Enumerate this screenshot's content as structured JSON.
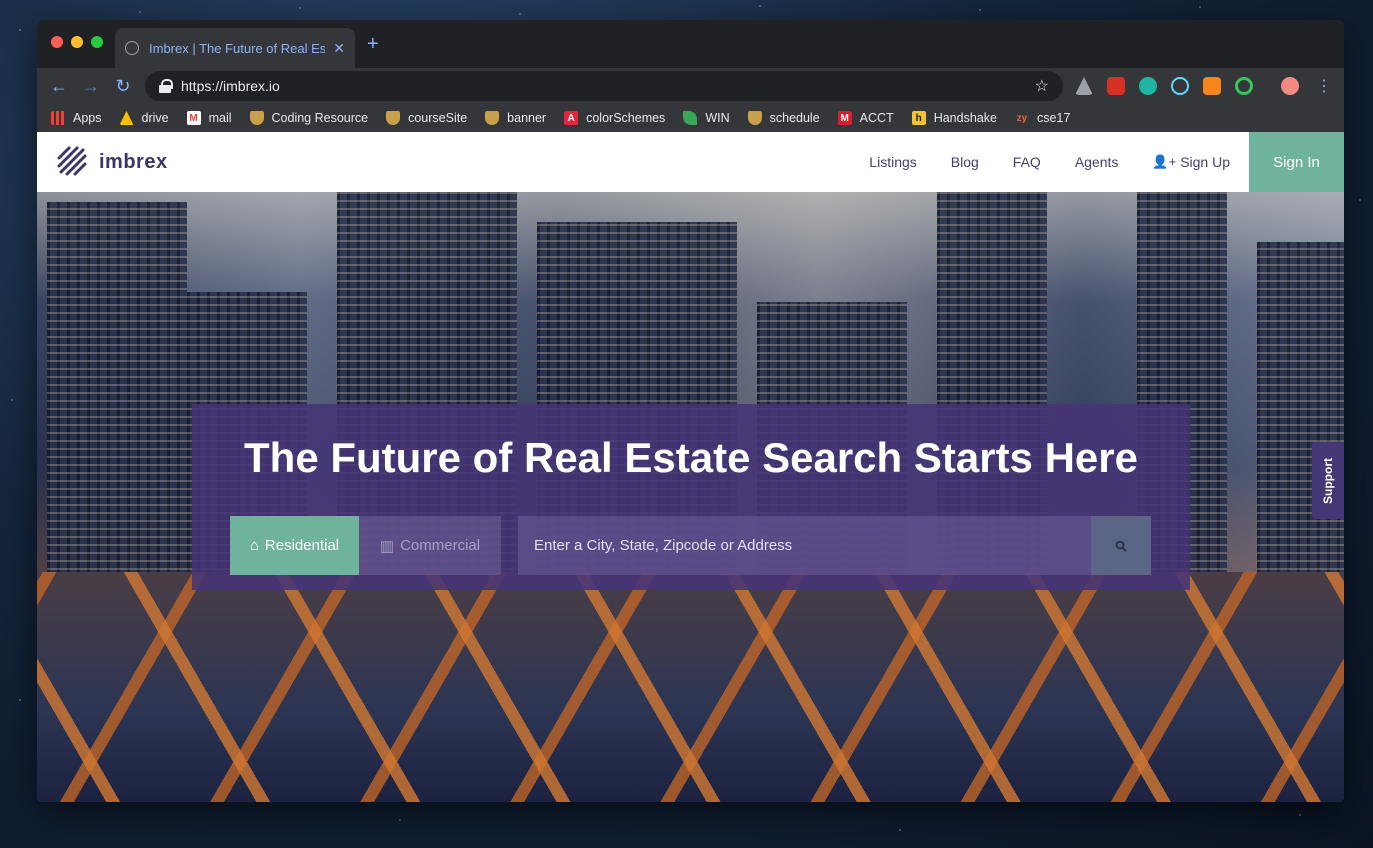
{
  "browser": {
    "tab_title": "Imbrex | The Future of Real Est",
    "url": "https://imbrex.io"
  },
  "bookmarks": [
    {
      "label": "Apps",
      "icon": "apps-grid-icon",
      "color": "#ea4335"
    },
    {
      "label": "drive",
      "icon": "google-drive-icon",
      "color": "#fbbc04"
    },
    {
      "label": "mail",
      "icon": "gmail-icon",
      "color": "#ea4335"
    },
    {
      "label": "Coding Resource",
      "icon": "shield-crest-icon",
      "color": "#c9a04a"
    },
    {
      "label": "courseSite",
      "icon": "shield-crest-icon",
      "color": "#c9a04a"
    },
    {
      "label": "banner",
      "icon": "shield-crest-icon",
      "color": "#c9a04a"
    },
    {
      "label": "colorSchemes",
      "icon": "adobe-icon",
      "color": "#e8233b"
    },
    {
      "label": "WIN",
      "icon": "leaf-icon",
      "color": "#3aa657"
    },
    {
      "label": "schedule",
      "icon": "shield-crest-icon",
      "color": "#c9a04a"
    },
    {
      "label": "ACCT",
      "icon": "m-logo-icon",
      "color": "#d81e2c"
    },
    {
      "label": "Handshake",
      "icon": "handshake-icon",
      "color": "#f1c232"
    },
    {
      "label": "cse17",
      "icon": "zy-icon",
      "color": "#e8613b"
    }
  ],
  "site": {
    "logo_text": "imbrex",
    "nav": {
      "listings": "Listings",
      "blog": "Blog",
      "faq": "FAQ",
      "agents": "Agents",
      "signup": "Sign Up",
      "signin": "Sign In"
    },
    "hero": {
      "title": "The Future of Real Estate Search Starts Here",
      "tab_residential": "Residential",
      "tab_commercial": "Commercial",
      "search_placeholder": "Enter a City, State, Zipcode or Address"
    },
    "support_label": "Support",
    "accent_color": "#6fb39c",
    "brand_color": "#453676"
  }
}
